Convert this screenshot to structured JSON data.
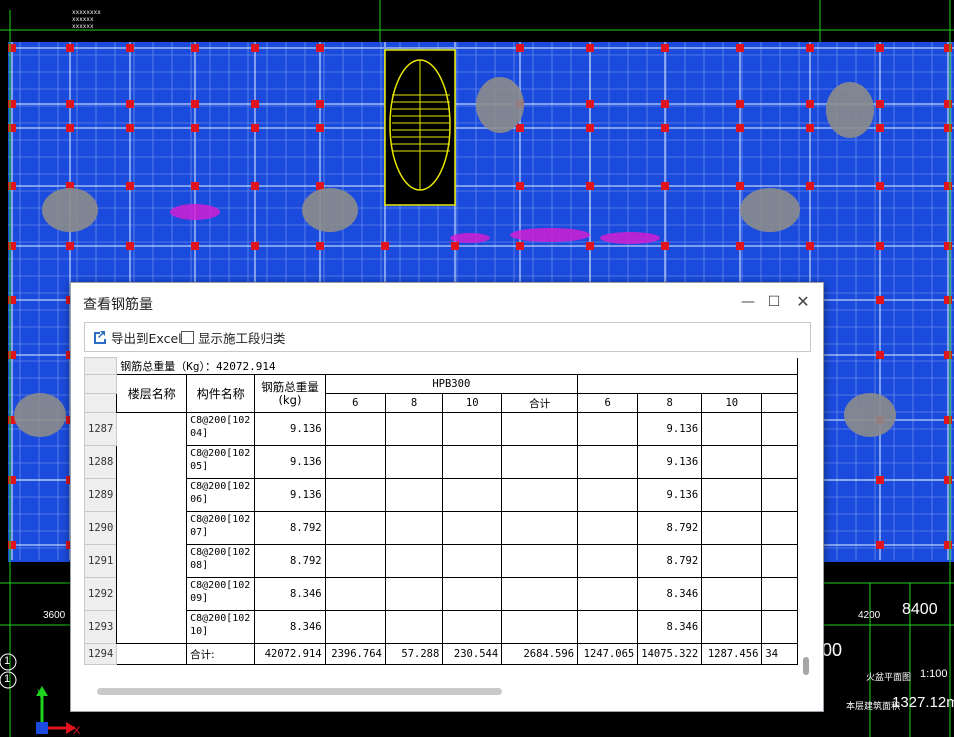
{
  "cad": {
    "top_small_text": [
      "xxxxxxxx",
      "xxxxxx",
      "xxxxxx"
    ],
    "dim_left": "3600",
    "dim_right_small": "4200",
    "dim_right_big": "8400",
    "right_label_1": "火盆平面图",
    "right_label_2": "1:100",
    "right_label_3": "本层建筑面积",
    "right_label_4": "1327.12m",
    "axis_left_1": "1",
    "axis_left_2": "1",
    "partial_number": "00",
    "colors": {
      "floor": "#1a4bdc",
      "grid": "#9ab4f0",
      "column": "#e0141e",
      "stair": "#e6e600"
    }
  },
  "dialog": {
    "title": "查看钢筋量",
    "toolbar": {
      "export_label": "导出到Excel",
      "show_stage_label": "显示施工段归类"
    },
    "table": {
      "total_label": "钢筋总重量（Kg）：42072.914",
      "headers": {
        "floor": "楼层名称",
        "component": "构件名称",
        "total_weight": "钢筋总重量(kg)",
        "group1": "HPB300",
        "sub1": [
          "6",
          "8",
          "10",
          "合计"
        ],
        "sub2": [
          "6",
          "8",
          "10"
        ]
      },
      "rows": [
        {
          "num": "1287",
          "name": "C8@200[10204]",
          "total": "9.136",
          "v8": "9.136"
        },
        {
          "num": "1288",
          "name": "C8@200[10205]",
          "total": "9.136",
          "v8": "9.136"
        },
        {
          "num": "1289",
          "name": "C8@200[10206]",
          "total": "9.136",
          "v8": "9.136"
        },
        {
          "num": "1290",
          "name": "C8@200[10207]",
          "total": "8.792",
          "v8": "8.792"
        },
        {
          "num": "1291",
          "name": "C8@200[10208]",
          "total": "8.792",
          "v8": "8.792"
        },
        {
          "num": "1292",
          "name": "C8@200[10209]",
          "total": "8.346",
          "v8": "8.346"
        },
        {
          "num": "1293",
          "name": "C8@200[10210]",
          "total": "8.346",
          "v8": "8.346"
        }
      ],
      "sum_row": {
        "num": "1294",
        "label": "合计:",
        "total": "42072.914",
        "hpb_6": "2396.764",
        "hpb_8": "57.288",
        "hpb_10": "230.544",
        "hpb_sum": "2684.596",
        "g2_6": "1247.065",
        "g2_8": "14075.322",
        "g2_10": "1287.456",
        "g2_next": "34"
      }
    }
  }
}
